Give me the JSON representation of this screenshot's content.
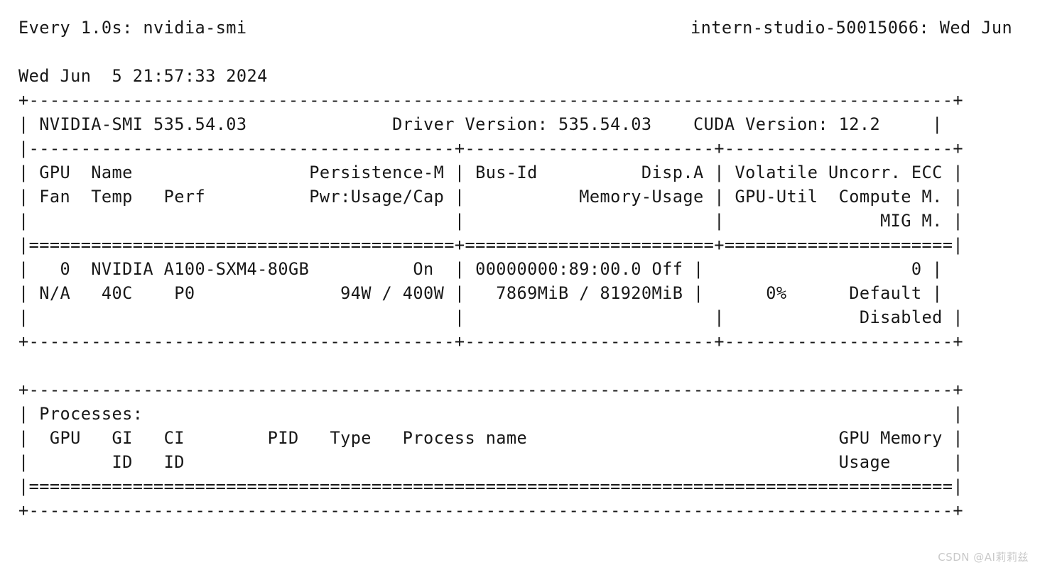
{
  "watch": {
    "interval_label": "Every 1.0s: nvidia-smi",
    "host_and_date": "intern-studio-50015066: Wed Jun",
    "timestamp": "Wed Jun  5 21:57:33 2024"
  },
  "smi": {
    "border_top": "+-----------------------------------------------------------------------------------------+",
    "version_row": "| NVIDIA-SMI 535.54.03              Driver Version: 535.54.03    CUDA Version: 12.2     |",
    "border_mid": "|-----------------------------------------+------------------------+----------------------+",
    "header_row_1": "| GPU  Name                 Persistence-M | Bus-Id          Disp.A | Volatile Uncorr. ECC |",
    "header_row_2": "| Fan  Temp   Perf          Pwr:Usage/Cap |           Memory-Usage | GPU-Util  Compute M. |",
    "header_row_3": "|                                         |                        |               MIG M. |",
    "separator_eq": "|=========================================+========================+======================|",
    "gpu_row_1": "|   0  NVIDIA A100-SXM4-80GB          On  | 00000000:89:00.0 Off |                    0 |",
    "gpu_row_2": "| N/A   40C    P0              94W / 400W |   7869MiB / 81920MiB |      0%      Default |",
    "gpu_row_3": "|                                         |                        |             Disabled |",
    "border_bottom": "+-----------------------------------------+------------------------+----------------------+"
  },
  "smi_fields": {
    "nvidia_smi_version": "535.54.03",
    "driver_version": "535.54.03",
    "cuda_version": "12.2",
    "gpu_index": "0",
    "gpu_name": "NVIDIA A100-SXM4-80GB",
    "persistence_mode": "On",
    "bus_id": "00000000:89:00.0",
    "disp_a": "Off",
    "ecc_errors": "0",
    "fan": "N/A",
    "temp": "40C",
    "perf": "P0",
    "power_usage": "94W",
    "power_cap": "400W",
    "memory_used": "7869MiB",
    "memory_total": "81920MiB",
    "gpu_util": "0%",
    "compute_mode": "Default",
    "mig_mode": "Disabled"
  },
  "processes": {
    "border_top": "+-----------------------------------------------------------------------------------------+",
    "title_row": "| Processes:                                                                              |",
    "header_row_1": "|  GPU   GI   CI        PID   Type   Process name                              GPU Memory |",
    "header_row_2": "|        ID   ID                                                               Usage      |",
    "separator_eq": "|=========================================================================================|",
    "border_bottom": "+-----------------------------------------------------------------------------------------+",
    "columns": [
      "GPU",
      "GI ID",
      "CI ID",
      "PID",
      "Type",
      "Process name",
      "GPU Memory Usage"
    ],
    "rows": []
  },
  "watermark": {
    "text": "CSDN @AI莉莉兹"
  },
  "colors": {
    "text": "#181818",
    "background": "#ffffff",
    "watermark": "#c9c9c9"
  }
}
